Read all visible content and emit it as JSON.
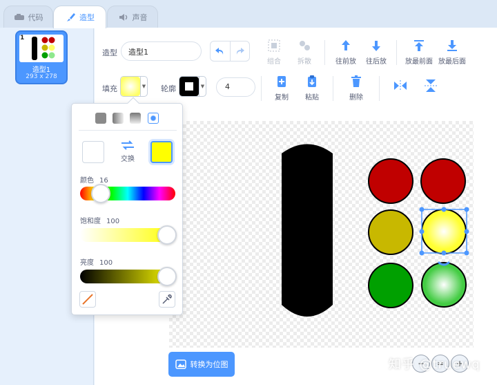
{
  "tabs": [
    {
      "label": "代码",
      "icon": "code-icon"
    },
    {
      "label": "造型",
      "icon": "brush-icon"
    },
    {
      "label": "声音",
      "icon": "speaker-icon"
    }
  ],
  "costume_list": [
    {
      "number": "1",
      "name": "造型1",
      "size": "293 x 278"
    }
  ],
  "toolbar": {
    "costume_label": "造型",
    "costume_name": "造型1",
    "group": "组合",
    "ungroup": "拆散",
    "forward": "往前放",
    "backward": "往后放",
    "front": "放最前面",
    "back": "放最后面",
    "fill_label": "填充",
    "outline_label": "轮廓",
    "outline_width": "4",
    "copy": "复制",
    "paste": "粘贴",
    "delete": "删除"
  },
  "fill_popup": {
    "swap_label": "交换",
    "color_label": "颜色",
    "color_value": "16",
    "color_level": 0.16,
    "saturation_label": "饱和度",
    "saturation_value": "100",
    "saturation_level": 1.0,
    "brightness_label": "亮度",
    "brightness_value": "100",
    "brightness_level": 1.0
  },
  "canvas": {
    "convert_label": "转换为位图"
  },
  "watermark": "知乎 @truewq",
  "colors": {
    "accent": "#4c97ff",
    "fill": "#ffff00",
    "red": "#c00000",
    "olive": "#c8b800",
    "green": "#00a000"
  }
}
